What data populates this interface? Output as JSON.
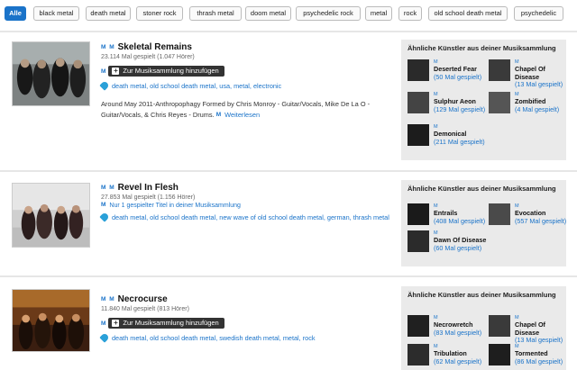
{
  "filters": [
    "Alle",
    "black metal",
    "death metal",
    "stoner rock",
    "thrash metal",
    "doom metal",
    "psychedelic rock",
    "metal",
    "rock",
    "old school death metal",
    "psychedelic"
  ],
  "mm": "M M",
  "m": "M",
  "similar_title": "Ähnliche Künstler aus deiner Musiksammlung",
  "artists": [
    {
      "name": "Skeletal Remains",
      "plays": "23.114 Mal gespielt (1.047 Hörer)",
      "add_button": "Zur Musiksammlung hinzufügen",
      "tags": "death metal, old school death metal, usa, metal, electronic",
      "bio": "Around May 2011-Anthropophagy Formed by Chris Monroy - Guitar/Vocals, Mike De La O - Guitar/Vocals, & Chris Reyes - Drums.",
      "bio_more": "Weiterlesen",
      "similar": [
        {
          "name": "Deserted Fear",
          "count": "(50 Mal gespielt)"
        },
        {
          "name": "Chapel Of Disease",
          "count": "(13 Mal gespielt)"
        },
        {
          "name": "Sulphur Aeon",
          "count": "(129 Mal gespielt)"
        },
        {
          "name": "Zombified",
          "count": "(4 Mal gespielt)"
        },
        {
          "name": "Demonical",
          "count": "(211 Mal gespielt)"
        }
      ]
    },
    {
      "name": "Revel In Flesh",
      "plays": "27.853 Mal gespielt (1.156 Hörer)",
      "library_note": "Nur 1 gespielter Titel in deiner Musiksammlung",
      "tags": "death metal, old school death metal, new wave of old school death metal, german, thrash metal",
      "similar": [
        {
          "name": "Entrails",
          "count": "(408 Mal gespielt)"
        },
        {
          "name": "Evocation",
          "count": "(557 Mal gespielt)"
        },
        {
          "name": "Dawn Of Disease",
          "count": "(60 Mal gespielt)"
        }
      ]
    },
    {
      "name": "Necrocurse",
      "plays": "11.840 Mal gespielt (813 Hörer)",
      "add_button": "Zur Musiksammlung hinzufügen",
      "tags": "death metal, old school death metal, swedish death metal, metal, rock",
      "similar": [
        {
          "name": "Necrowretch",
          "count": "(83 Mal gespielt)"
        },
        {
          "name": "Chapel Of Disease",
          "count": "(13 Mal gespielt)"
        },
        {
          "name": "Tribulation",
          "count": "(62 Mal gespielt)"
        },
        {
          "name": "Tormented",
          "count": "(86 Mal gespielt)"
        }
      ]
    }
  ]
}
